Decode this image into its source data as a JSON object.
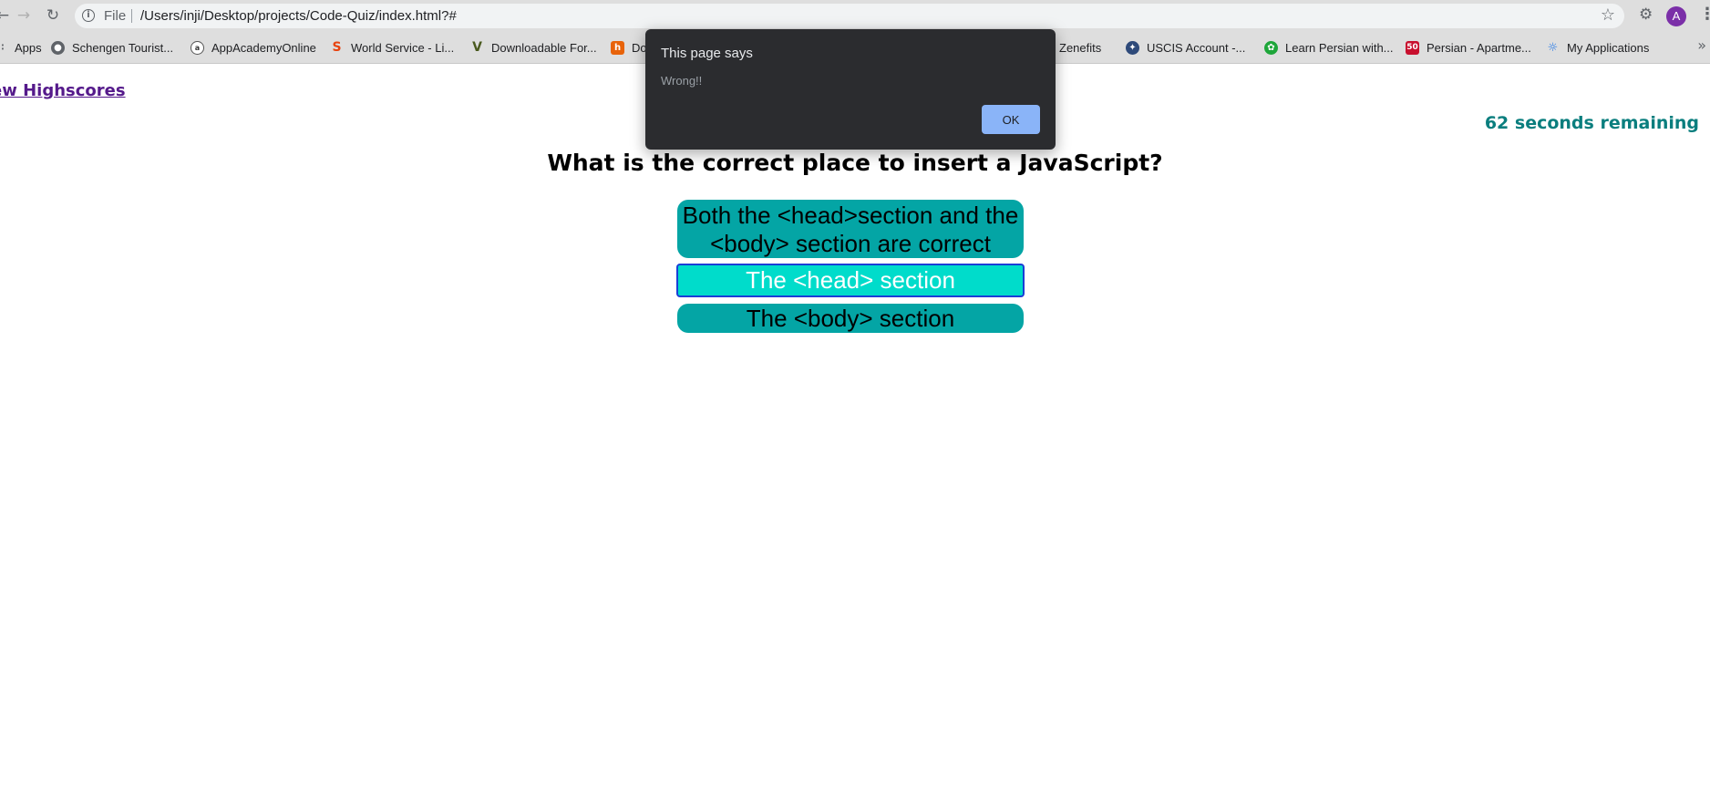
{
  "browser": {
    "url_scheme": "File",
    "url": "/Users/inji/Desktop/projects/Code-Quiz/index.html?#",
    "avatar_letter": "A",
    "bookmarks": [
      {
        "label": "Apps",
        "icon": "apps-grid-icon"
      },
      {
        "label": "Schengen Tourist...",
        "icon": "globe-icon"
      },
      {
        "label": "AppAcademyOnline",
        "icon": "app-academy-icon"
      },
      {
        "label": "World Service - Li...",
        "icon": "world-service-icon"
      },
      {
        "label": "Downloadable For...",
        "icon": "v-logo-icon"
      },
      {
        "label": "Do",
        "icon": "orange-site-icon"
      },
      {
        "label": "Zenefits",
        "icon": "zenefits-icon"
      },
      {
        "label": "USCIS Account -...",
        "icon": "uscis-seal-icon"
      },
      {
        "label": "Learn Persian with...",
        "icon": "green-leaf-icon"
      },
      {
        "label": "Persian - Apartme...",
        "icon": "red-50-icon"
      },
      {
        "label": "My Applications",
        "icon": "lightbulb-icon"
      }
    ],
    "bookmark_badge_text": "50"
  },
  "page": {
    "highscores_link": "ew Highscores",
    "timer_text": "62 seconds remaining",
    "question": "What is the correct place to insert a JavaScript?",
    "answers": [
      {
        "line1": "Both the <head>section and the",
        "line2": "<body> section are correct"
      },
      {
        "text": "The <head> section"
      },
      {
        "text": "The <body> section"
      }
    ]
  },
  "dialog": {
    "title": "This page says",
    "message": "Wrong!!",
    "ok_label": "OK"
  },
  "colors": {
    "answer_bg": "#04a5a5",
    "answer_selected_bg": "#00dccb",
    "timer": "#0a7e7e",
    "dialog_bg": "#2b2c2f",
    "dialog_button": "#8ab4f8"
  }
}
